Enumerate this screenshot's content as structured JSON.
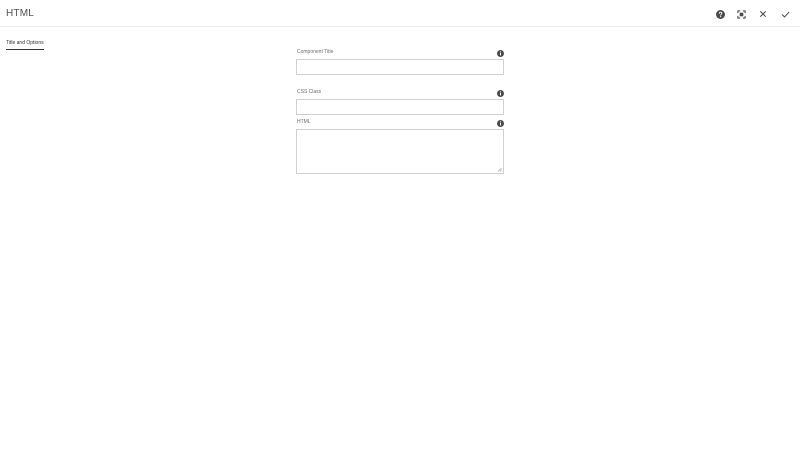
{
  "dialog": {
    "title": "HTML"
  },
  "header": {
    "buttons": [
      {
        "name": "help-button",
        "icon": "help-circle-icon"
      },
      {
        "name": "fullscreen-button",
        "icon": "fullscreen-icon"
      },
      {
        "name": "cancel-button",
        "icon": "close-icon"
      },
      {
        "name": "done-button",
        "icon": "check-icon"
      }
    ]
  },
  "tabs": [
    {
      "label": "Title and Options",
      "active": true
    }
  ],
  "form": {
    "fields": [
      {
        "label": "Component Title",
        "value": "",
        "type": "text",
        "info_icon": "info-icon"
      },
      {
        "label": "CSS Class",
        "value": "",
        "type": "text",
        "info_icon": "info-icon"
      },
      {
        "label": "HTML",
        "value": "",
        "type": "textarea",
        "info_icon": "info-icon"
      }
    ]
  },
  "colors": {
    "icon": "#4b4b4b",
    "border": "#d0d0d0",
    "tab_underline": "#333333"
  }
}
